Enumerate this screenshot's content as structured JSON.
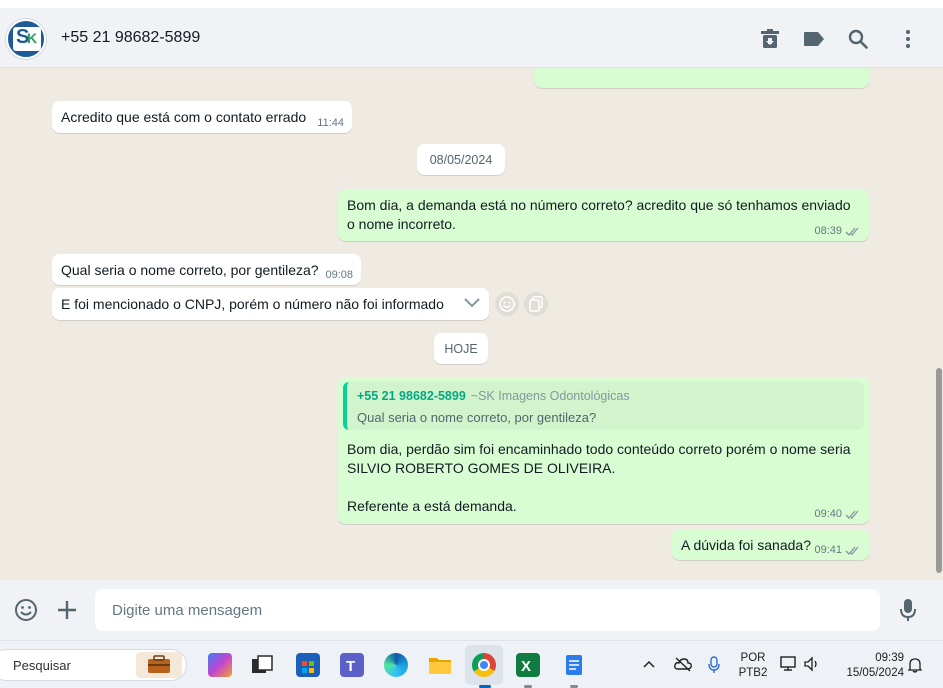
{
  "header": {
    "contact_name": "+55 21 98682-5899",
    "avatar_letters": [
      "S",
      "K"
    ],
    "icons": [
      "archive-icon",
      "label-icon",
      "search-icon",
      "menu-icon"
    ]
  },
  "messages": {
    "m1": {
      "text": "Acredito que está com o contato errado",
      "time": "11:44"
    },
    "date1": "08/05/2024",
    "m2": {
      "line1": "Bom dia, a demanda está no número correto? acredito que só tenhamos enviado",
      "line2": "o nome incorreto.",
      "time": "08:39"
    },
    "m3": {
      "text": "Qual seria o nome correto, por gentileza?",
      "time": "09:08"
    },
    "m4": {
      "text": "E foi mencionado o CNPJ, porém o número não foi informado"
    },
    "date2": "HOJE",
    "m5": {
      "quote_author": "+55 21 98682-5899",
      "quote_author_alias": "~SK Imagens Odontológicas",
      "quote_text": "Qual seria o nome correto, por gentileza?",
      "line1": "Bom dia, perdão sim foi encaminhado todo conteúdo correto porém o nome seria",
      "line2": "SILVIO ROBERTO GOMES DE OLIVEIRA.",
      "line3": "Referente a está demanda.",
      "time": "09:40"
    },
    "m6": {
      "text": "A dúvida foi sanada?",
      "time": "09:41"
    }
  },
  "composer": {
    "placeholder": "Digite uma mensagem"
  },
  "taskbar": {
    "search_label": "Pesquisar",
    "language": "POR",
    "layout": "PTB2",
    "time": "09:39",
    "date": "15/05/2024"
  },
  "colors": {
    "outgoing": "#d9fdd3",
    "incoming": "#ffffff",
    "chat_bg": "#efeae2",
    "accent": "#06cf9c"
  }
}
